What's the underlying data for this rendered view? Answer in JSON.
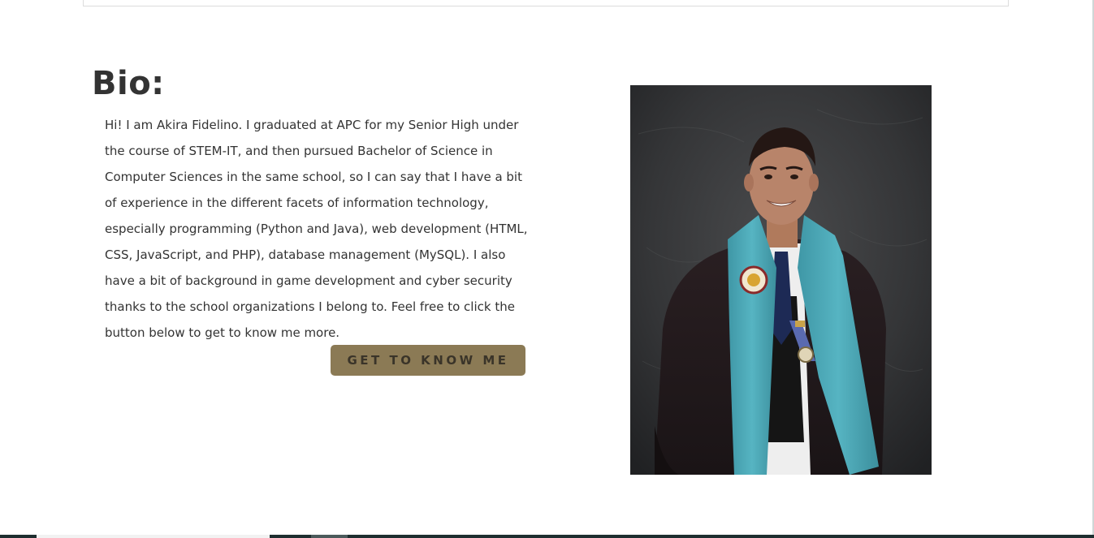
{
  "bio": {
    "title": "Bio:",
    "text": "Hi! I am Akira Fidelino. I graduated at APC for my Senior High under the course of STEM-IT, and then pursued Bachelor of Science in Computer Sciences in the same school, so I can say that I have a bit of experience in the different facets of information technology, especially programming (Python and Java), web development (HTML, CSS, JavaScript, and PHP), database management (MySQL). I also have a bit of background in game development and cyber security thanks to the school organizations I belong to. Feel free to click the button below to get to know me more.",
    "button_label": "GET TO KNOW ME"
  },
  "colors": {
    "button_bg": "#8b7a55",
    "button_text": "#3a3429",
    "stole": "#49a9b8",
    "background": "#ffffff"
  }
}
